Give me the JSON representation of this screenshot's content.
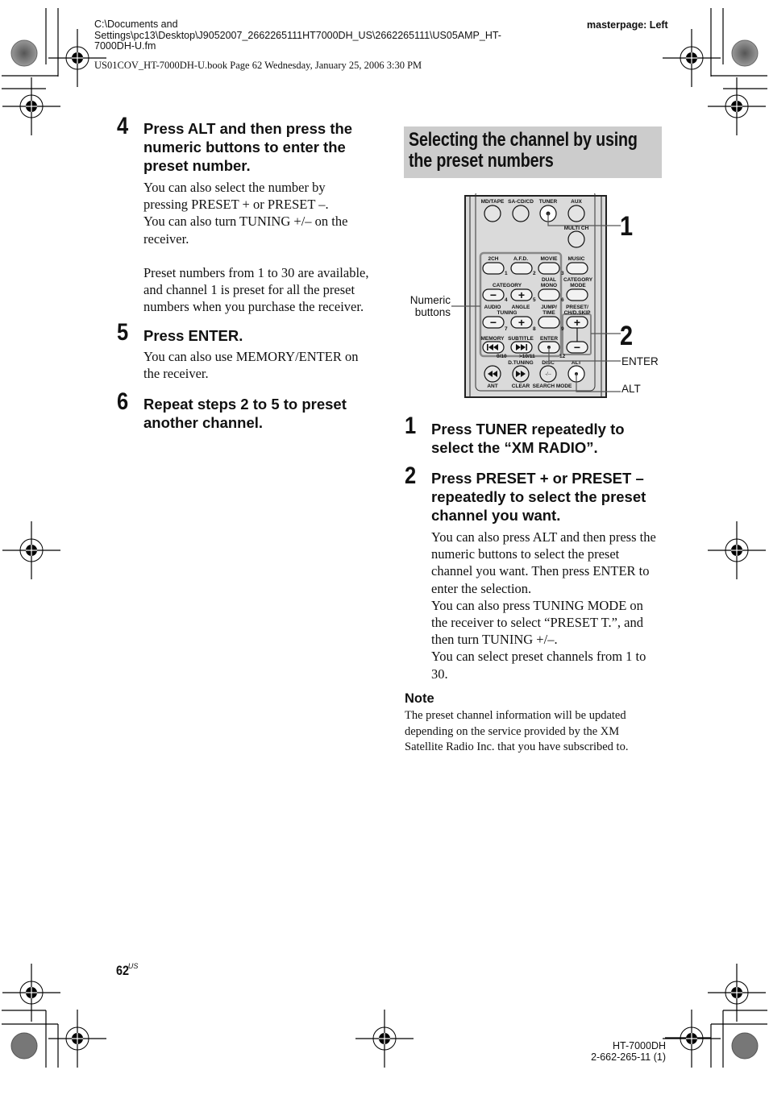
{
  "header": {
    "path_line1": "C:\\Documents and",
    "path_line2": "Settings\\pc13\\Desktop\\J9052007_2662265111HT7000DH_US\\2662265111\\US05AMP_HT-",
    "path_line3": "7000DH-U.fm",
    "book_info": "US01COV_HT-7000DH-U.book  Page 62  Wednesday, January 25, 2006  3:30 PM",
    "masterpage": "masterpage: Left"
  },
  "left_column": {
    "steps": [
      {
        "number": "4",
        "heading": [
          "Press ALT and then press the",
          "numeric buttons to enter the",
          "preset number."
        ],
        "body": [
          "You can also select the number by",
          "pressing PRESET + or PRESET –.",
          "You can also turn TUNING +/– on the",
          "receiver.",
          "",
          "Preset numbers from 1 to 30 are available,",
          "and channel 1 is preset for all the preset",
          "numbers when you purchase the receiver."
        ]
      },
      {
        "number": "5",
        "heading": [
          "Press ENTER."
        ],
        "body": [
          "You can also use MEMORY/ENTER on",
          "the receiver."
        ]
      },
      {
        "number": "6",
        "heading": [
          "Repeat steps 2 to 5 to preset",
          "another channel."
        ],
        "body": []
      }
    ]
  },
  "right_column": {
    "section_title": [
      "Selecting the channel by using",
      "the preset numbers"
    ],
    "remote": {
      "row1_labels": [
        "MD/TAPE",
        "SA-CD/CD",
        "TUNER",
        "AUX"
      ],
      "multi_ch": "MULTI CH",
      "row3_labels": [
        "2CH",
        "A.F.D.",
        "MOVIE",
        "MUSIC"
      ],
      "row3_nums": [
        "1",
        "2",
        "3"
      ],
      "category": "CATEGORY",
      "dual_mono": [
        "DUAL",
        "MONO"
      ],
      "category_mode": [
        "CATEGORY",
        "MODE"
      ],
      "row4_nums": [
        "4",
        "5",
        "6"
      ],
      "audio": "AUDIO",
      "angle": "ANGLE",
      "tuning": "TUNING",
      "jump_time": [
        "JUMP/",
        "TIME"
      ],
      "preset_skip": [
        "PRESET/",
        "CH/D.SKIP"
      ],
      "row5_nums": [
        "7",
        "8",
        "9"
      ],
      "memory": "MEMORY",
      "subtitle": "SUBTITLE",
      "enter": "ENTER",
      "row6_nums": [
        "0/10",
        ">10/11",
        "12"
      ],
      "d_tuning": "D.TUNING",
      "disc": "DISC",
      "alt": "ALT",
      "bottom_labels": [
        "ANT",
        "CLEAR",
        "SEARCH MODE"
      ],
      "minus_symbol": "−",
      "plus_symbol": "+",
      "dash_symbol": "-/--"
    },
    "callouts": {
      "numeric_buttons": [
        "Numeric",
        "buttons"
      ],
      "one": "1",
      "two": "2",
      "enter": "ENTER",
      "alt": "ALT"
    },
    "steps": [
      {
        "number": "1",
        "heading": [
          "Press TUNER repeatedly to",
          "select the “XM RADIO”."
        ],
        "body": []
      },
      {
        "number": "2",
        "heading": [
          "Press PRESET + or PRESET –",
          "repeatedly to select the preset",
          "channel you want."
        ],
        "body": [
          "You can also press ALT and then press the",
          "numeric buttons to select the preset",
          "channel you want. Then press ENTER to",
          "enter the selection.",
          "You can also press TUNING MODE on",
          "the receiver to select “PRESET T.”, and",
          "then turn TUNING +/–.",
          "You can select preset channels from 1 to",
          "30."
        ]
      }
    ],
    "note": {
      "title": "Note",
      "lines": [
        "The preset channel information will be updated",
        "depending on the service provided by the XM",
        "Satellite Radio Inc. that you have subscribed to."
      ]
    }
  },
  "footer": {
    "page_number": "62",
    "page_suffix": "US",
    "model": "HT-7000DH",
    "code": "2-662-265-11 (1)"
  }
}
